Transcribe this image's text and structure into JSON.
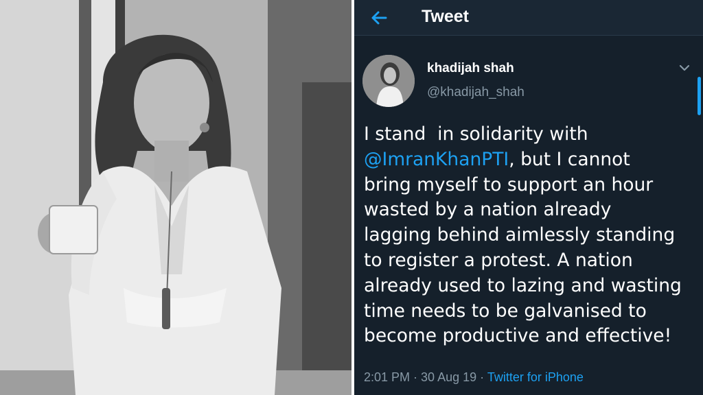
{
  "header": {
    "title": "Tweet",
    "back_icon": "arrow-left-icon"
  },
  "author": {
    "display_name": "khadijah shah",
    "handle": "@khadijah_shah",
    "menu_icon": "chevron-down-icon"
  },
  "tweet": {
    "line1": "I stand  in solidarity with",
    "mention": "@ImranKhanPTI",
    "after_mention": ", but I cannot",
    "rest": "bring myself to support an hour\nwasted by a nation already\nlagging behind aimlessly standing\nto register a protest. A nation\nalready used to lazing and wasting\ntime needs to be galvanised to\nbecome productive and effective!",
    "time": "2:01 PM",
    "separator": " · ",
    "date": "30 Aug 19",
    "separator2": " · ",
    "source": "Twitter for iPhone"
  },
  "colors": {
    "background": "#15202b",
    "accent": "#1da1f2",
    "muted": "#8899a6"
  }
}
